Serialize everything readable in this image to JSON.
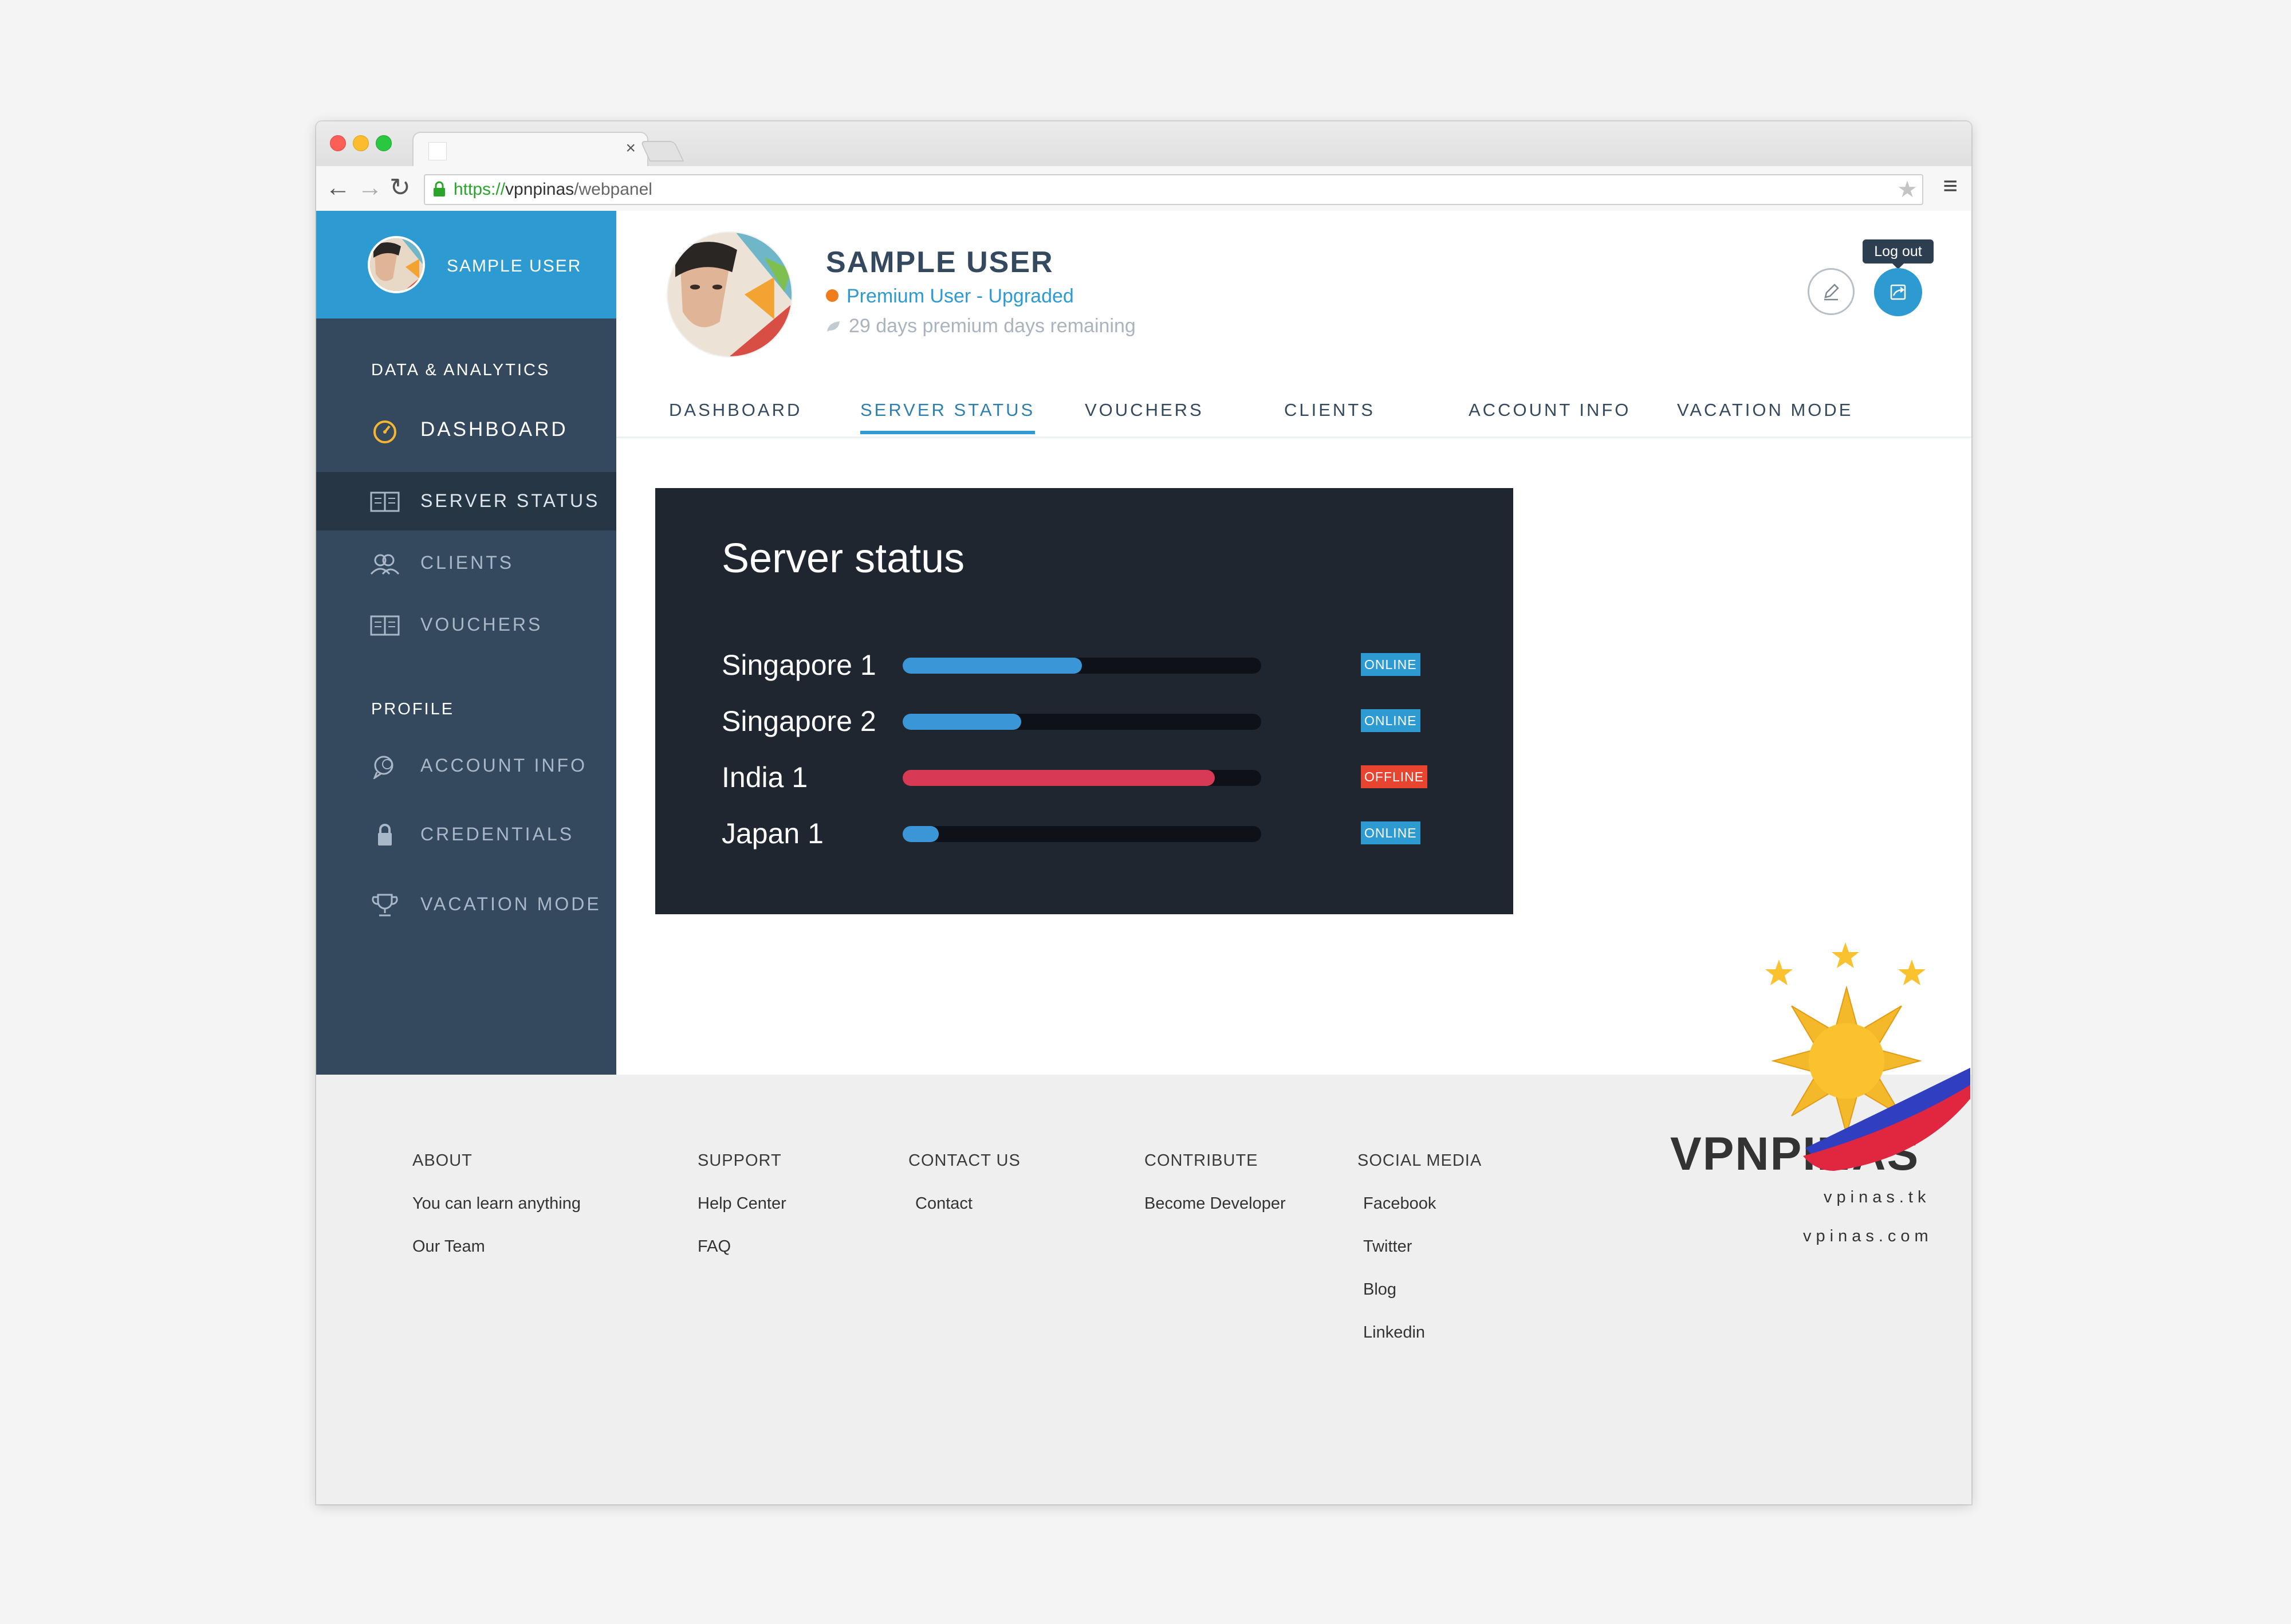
{
  "browser": {
    "url_scheme": "https://",
    "url_domain": "vpnpinas",
    "url_path": "/webpanel",
    "tab_close": "×"
  },
  "sidebar": {
    "user_name": "SAMPLE USER",
    "section_data": "DATA & ANALYTICS",
    "section_profile": "PROFILE",
    "items": [
      {
        "label": "DASHBOARD",
        "icon": "speedometer-icon"
      },
      {
        "label": "SERVER STATUS",
        "icon": "book-icon"
      },
      {
        "label": "CLIENTS",
        "icon": "users-icon"
      },
      {
        "label": "VOUCHERS",
        "icon": "book-icon"
      },
      {
        "label": "ACCOUNT INFO",
        "icon": "chat-icon"
      },
      {
        "label": "CREDENTIALS",
        "icon": "lock-icon"
      },
      {
        "label": "VACATION MODE",
        "icon": "trophy-icon"
      }
    ]
  },
  "profile": {
    "name": "SAMPLE USER",
    "status": "Premium User - Upgraded",
    "days_remaining": "29 days premium days remaining",
    "logout_tooltip": "Log out"
  },
  "tabs": [
    "DASHBOARD",
    "SERVER STATUS",
    "VOUCHERS",
    "CLIENTS",
    "ACCOUNT INFO",
    "VACATION MODE"
  ],
  "active_tab": "SERVER STATUS",
  "server_panel": {
    "title": "Server status",
    "servers": [
      {
        "name": "Singapore 1",
        "load": 0.5,
        "status": "ONLINE",
        "color": "#3a96d6",
        "badge_color": "#2d9ad2"
      },
      {
        "name": "Singapore 2",
        "load": 0.33,
        "status": "ONLINE",
        "color": "#3a96d6",
        "badge_color": "#2d9ad2"
      },
      {
        "name": "India 1",
        "load": 0.87,
        "status": "OFFLINE",
        "color": "#d83a55",
        "badge_color": "#e8442f"
      },
      {
        "name": "Japan 1",
        "load": 0.1,
        "status": "ONLINE",
        "color": "#3a96d6",
        "badge_color": "#2d9ad2"
      }
    ]
  },
  "footer": {
    "columns": [
      {
        "heading": "ABOUT",
        "links": [
          "You can learn anything",
          "Our Team"
        ]
      },
      {
        "heading": "SUPPORT",
        "links": [
          "Help Center",
          "FAQ"
        ]
      },
      {
        "heading": "CONTACT US",
        "links": [
          "Contact"
        ]
      },
      {
        "heading": "CONTRIBUTE",
        "links": [
          "Become Developer"
        ]
      },
      {
        "heading": "SOCIAL MEDIA",
        "links": [
          "Facebook",
          "Twitter",
          "Blog",
          "Linkedin"
        ]
      }
    ],
    "brand": "VPNPINAS",
    "brand_urls": [
      "vpinas.tk",
      "vpinas.com"
    ]
  },
  "colors": {
    "accent": "#2d9ad2",
    "sidebar": "#34495e",
    "panel": "#1f262f",
    "online": "#2d9ad2",
    "offline": "#e8442f"
  }
}
